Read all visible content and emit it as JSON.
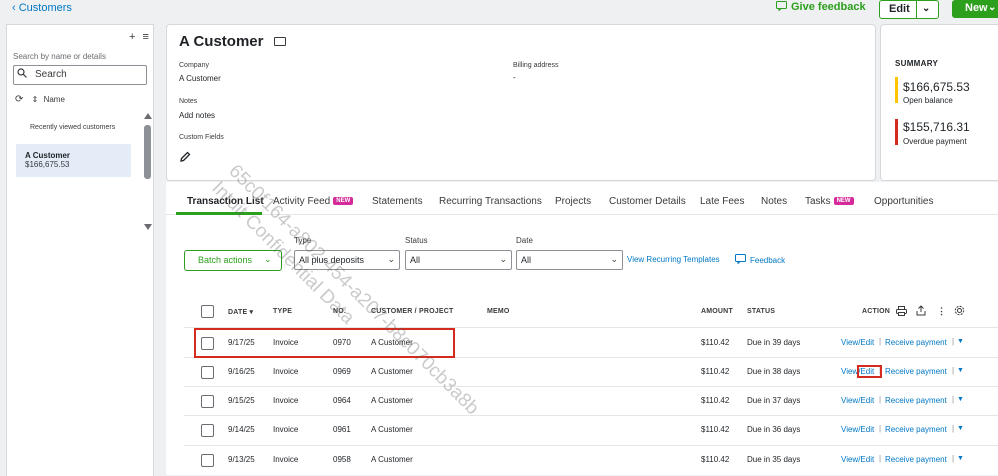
{
  "topbar": {
    "back_label": "Customers",
    "feedback_label": "Give feedback",
    "edit_label": "Edit",
    "new_label": "New"
  },
  "left_panel": {
    "search_hint": "Search by name or details",
    "search_placeholder": "Search",
    "sort_label": "Name",
    "recent_label": "Recently viewed customers",
    "recent_customer": {
      "name": "A Customer",
      "amount": "$166,675.53"
    }
  },
  "customer": {
    "name": "A Customer",
    "company_label": "Company",
    "company_value": "A Customer",
    "billing_label": "Billing address",
    "billing_value": "-",
    "notes_label": "Notes",
    "add_notes": "Add notes",
    "custom_fields_label": "Custom Fields"
  },
  "summary": {
    "title": "SUMMARY",
    "open_balance": "$166,675.53",
    "open_balance_label": "Open balance",
    "overdue": "$155,716.31",
    "overdue_label": "Overdue payment",
    "colors": {
      "open": "#ffc400",
      "overdue": "#d52b1e"
    }
  },
  "tabs": [
    {
      "label": "Transaction List",
      "active": true
    },
    {
      "label": "Activity Feed",
      "badge": "NEW"
    },
    {
      "label": "Statements"
    },
    {
      "label": "Recurring Transactions"
    },
    {
      "label": "Projects"
    },
    {
      "label": "Customer Details"
    },
    {
      "label": "Late Fees"
    },
    {
      "label": "Notes"
    },
    {
      "label": "Tasks",
      "badge": "NEW"
    },
    {
      "label": "Opportunities"
    }
  ],
  "filters": {
    "batch_actions": "Batch actions",
    "type_label": "Type",
    "type_value": "All plus deposits",
    "status_label": "Status",
    "status_value": "All",
    "date_label": "Date",
    "date_value": "All",
    "view_recurring": "View Recurring Templates",
    "feedback": "Feedback"
  },
  "table": {
    "headers": {
      "date": "DATE",
      "type": "TYPE",
      "no": "NO.",
      "customer": "CUSTOMER / PROJECT",
      "memo": "MEMO",
      "amount": "AMOUNT",
      "status": "STATUS",
      "action": "ACTION"
    },
    "rows": [
      {
        "date": "9/17/25",
        "type": "Invoice",
        "no": "0970",
        "customer": "A Customer",
        "memo": "",
        "amount": "$110.42",
        "status": "Due in 39 days",
        "view_edit": "View/Edit",
        "receive": "Receive payment"
      },
      {
        "date": "9/16/25",
        "type": "Invoice",
        "no": "0969",
        "customer": "A Customer",
        "memo": "",
        "amount": "$110.42",
        "status": "Due in 38 days",
        "view_edit": "View/Edit",
        "receive": "Receive payment"
      },
      {
        "date": "9/15/25",
        "type": "Invoice",
        "no": "0964",
        "customer": "A Customer",
        "memo": "",
        "amount": "$110.42",
        "status": "Due in 37 days",
        "view_edit": "View/Edit",
        "receive": "Receive payment"
      },
      {
        "date": "9/14/25",
        "type": "Invoice",
        "no": "0961",
        "customer": "A Customer",
        "memo": "",
        "amount": "$110.42",
        "status": "Due in 36 days",
        "view_edit": "View/Edit",
        "receive": "Receive payment"
      },
      {
        "date": "9/13/25",
        "type": "Invoice",
        "no": "0958",
        "customer": "A Customer",
        "memo": "",
        "amount": "$110.42",
        "status": "Due in 35 days",
        "view_edit": "View/Edit",
        "receive": "Receive payment"
      }
    ]
  },
  "watermark": [
    "65c0f164-a802-454-a207-b8c070cb3a8b",
    "Intuit Confidential Data"
  ],
  "icons": [
    "chevron-left-icon",
    "feedback-icon",
    "chevron-down-icon",
    "plus-icon",
    "list-settings-icon",
    "search-icon",
    "history-icon",
    "sort-icon",
    "mail-icon",
    "pencil-icon",
    "print-icon",
    "export-icon",
    "more-icon",
    "gear-icon"
  ],
  "accent_color": "#2ca01c"
}
